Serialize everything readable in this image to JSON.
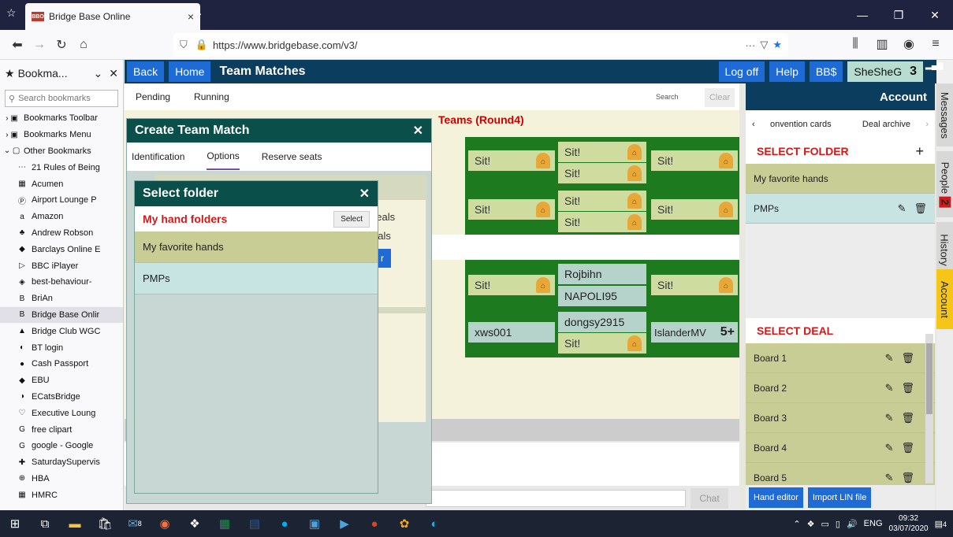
{
  "browser": {
    "tab_title": "Bridge Base Online",
    "tab_favicon": "BBO",
    "url": "https://www.bridgebase.com/v3/",
    "url_tail": "···",
    "new_tab": "+",
    "tab_close": "×"
  },
  "bookmarks": {
    "header": "Bookma...",
    "search_placeholder": "Search bookmarks",
    "items": [
      {
        "label": "Bookmarks Toolbar",
        "icon": "folder-icon",
        "top": true
      },
      {
        "label": "Bookmarks Menu",
        "icon": "folder-icon",
        "top": true
      },
      {
        "label": "Other Bookmarks",
        "icon": "folder-icon",
        "top": true
      },
      {
        "label": "21 Rules of Being"
      },
      {
        "label": "Acumen"
      },
      {
        "label": "Airport Lounge P"
      },
      {
        "label": "Amazon"
      },
      {
        "label": "Andrew Robson"
      },
      {
        "label": "Barclays Online E"
      },
      {
        "label": "BBC iPlayer"
      },
      {
        "label": "best-behaviour-"
      },
      {
        "label": "BriAn"
      },
      {
        "label": "Bridge Base Onlir",
        "selected": true
      },
      {
        "label": "Bridge Club WGC"
      },
      {
        "label": "BT login"
      },
      {
        "label": "Cash Passport"
      },
      {
        "label": "EBU"
      },
      {
        "label": "ECatsBridge"
      },
      {
        "label": "Executive Loung"
      },
      {
        "label": "free clipart"
      },
      {
        "label": "google - Google"
      },
      {
        "label": "SaturdaySupervis"
      },
      {
        "label": "HBA"
      },
      {
        "label": "HMRC"
      }
    ]
  },
  "bbo": {
    "back": "Back",
    "home": "Home",
    "title": "Team Matches",
    "logoff": "Log off",
    "help": "Help",
    "bbdollars": "BB$",
    "username": "SheSheG",
    "user_count": "3"
  },
  "team_matches": {
    "tab_pending": "Pending",
    "tab_running": "Running",
    "search_label": "Search",
    "clear_label": "Clear",
    "heading_visible": "Teams (Round4)",
    "chat_label": "Chat",
    "sit": "Sit!",
    "players": {
      "rojbihn": "Rojbihn",
      "napoli95": "NAPOLI95",
      "xws001": "xws001",
      "dongsy2915": "dongsy2915",
      "islandermv": "IslanderMV",
      "islandermv_badge": "5+"
    }
  },
  "create_team_match": {
    "title": "Create Team Match",
    "tabs": [
      "Identification",
      "Options",
      "Reserve seats"
    ],
    "bg_text1": "deals",
    "bg_text2": "eals",
    "bg_btn": "r"
  },
  "select_folder": {
    "title": "Select folder",
    "subheading": "My hand folders",
    "select_button": "Select",
    "items": [
      "My favorite hands",
      "PMPs"
    ]
  },
  "account": {
    "title": "Account",
    "tab_left": "onvention cards",
    "tab_right": "Deal archive",
    "select_folder_heading": "SELECT FOLDER",
    "folders": [
      "My favorite hands",
      "PMPs"
    ],
    "select_deal_heading": "SELECT DEAL",
    "deals": [
      "Board 1",
      "Board 2",
      "Board 3",
      "Board 4",
      "Board 5"
    ],
    "hand_editor": "Hand editor",
    "import_lin": "Import LIN file"
  },
  "side_tabs": {
    "messages": "Messages",
    "people": "People",
    "people_badge": "2",
    "history": "History",
    "account": "Account"
  },
  "taskbar": {
    "badge_mail": "8",
    "language": "ENG",
    "time": "09:32",
    "date": "03/07/2020",
    "notifications": "4"
  },
  "colors": {
    "bbo_navy": "#0b3d5f",
    "bbo_blue": "#1e6bd6",
    "dialog_teal": "#0b4f4a",
    "table_green": "#1d7a1f",
    "heading_red": "#d01a1a"
  }
}
